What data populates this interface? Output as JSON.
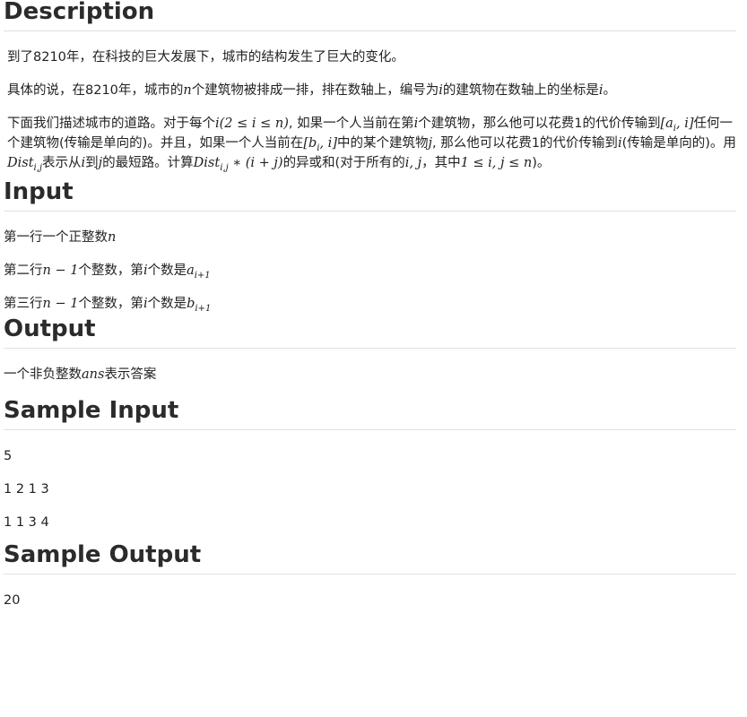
{
  "description": {
    "heading": "Description",
    "p1": "到了8210年，在科技的巨大发展下，城市的结构发生了巨大的变化。",
    "p2": {
      "a": "具体的说，在8210年，城市的",
      "n": "n",
      "b": "个建筑物被排成一排，排在数轴上，编号为",
      "i": "i",
      "c": "的建筑物在数轴上的坐标是",
      "i2": "i",
      "d": "。"
    },
    "p3": {
      "a": "下面我们描述城市的道路。对于每个",
      "cond": "i(2 ≤ i ≤ n)",
      "b": ", 如果一个人当前在第",
      "i1": "i",
      "c": "个建筑物，那么他可以花费1的代价传输到",
      "range1": "[a",
      "range1_sub": "i",
      "range1_end": ", i]",
      "d": "任何一个建筑物(传输是单向的)。并且，如果一个人当前在",
      "range2": "[b",
      "range2_sub": "i",
      "range2_end": ", i]",
      "e": "中的某个建筑物",
      "j": "j",
      "f": ", 那么他可以花费1的代价传输到",
      "i2": "i",
      "g": "(传输是单向的)。用",
      "dist": "Dist",
      "dist_sub": "i,j",
      "h": "表示从",
      "i3": "i",
      "k": "到",
      "j2": "j",
      "l": "的最短路。计算",
      "dist2": "Dist",
      "dist2_sub": "i,j",
      "expr": " ∗ (i + j)",
      "m": "的异或和(对于所有的",
      "ij": "i, j",
      "n": "，其中",
      "cond2": "1 ≤ i, j ≤ n",
      "o": ")。"
    }
  },
  "input": {
    "heading": "Input",
    "l1": {
      "a": "第一行一个正整数",
      "n": "n"
    },
    "l2": {
      "a": "第二行",
      "expr": "n − 1",
      "b": "个整数，第",
      "i": "i",
      "c": "个数是",
      "v": "a",
      "sub": "i+1"
    },
    "l3": {
      "a": "第三行",
      "expr": "n − 1",
      "b": "个整数，第",
      "i": "i",
      "c": "个数是",
      "v": "b",
      "sub": "i+1"
    }
  },
  "output": {
    "heading": "Output",
    "l1": {
      "a": "一个非负整数",
      "ans": "ans",
      "b": "表示答案"
    }
  },
  "sample_input": {
    "heading": "Sample Input",
    "lines": [
      "5",
      "1 2 1 3",
      "1 1 3 4"
    ]
  },
  "sample_output": {
    "heading": "Sample Output",
    "lines": [
      "20"
    ]
  }
}
